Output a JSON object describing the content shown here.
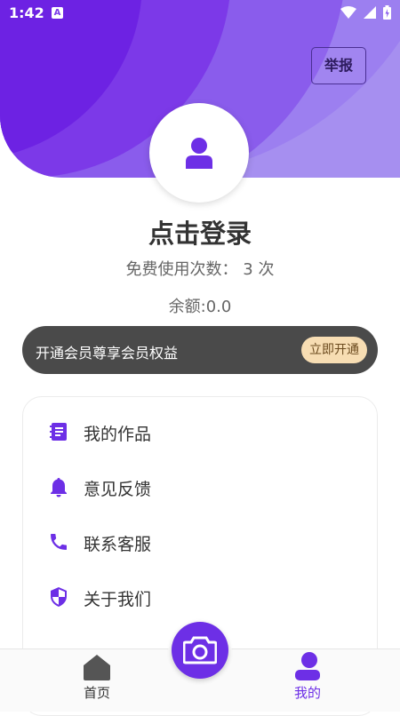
{
  "status_bar": {
    "time": "1:42",
    "badge": "A"
  },
  "header": {
    "report_label": "举报"
  },
  "profile": {
    "login_title": "点击登录",
    "usage_text": "免费使用次数： 3 次",
    "balance_text": "余额:0.0"
  },
  "vip": {
    "text": "开通会员尊享会员权益",
    "button_label": "立即开通"
  },
  "menu": {
    "items": [
      {
        "label": "我的作品",
        "icon": "works-icon"
      },
      {
        "label": "意见反馈",
        "icon": "bell-icon"
      },
      {
        "label": "联系客服",
        "icon": "phone-icon"
      },
      {
        "label": "关于我们",
        "icon": "shield-icon"
      }
    ]
  },
  "bottom_nav": {
    "home_label": "首页",
    "mine_label": "我的",
    "active": "mine"
  },
  "colors": {
    "accent": "#6d2fe6",
    "banner_bg": "#4a4a4a",
    "banner_button": "#f7ddb3"
  }
}
